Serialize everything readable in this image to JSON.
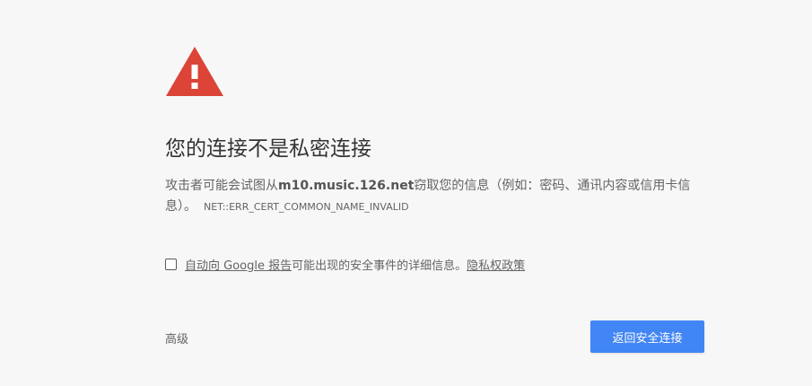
{
  "icon": {
    "name": "warning-icon",
    "color": "#db4437"
  },
  "title": "您的连接不是私密连接",
  "description": {
    "before_host": "攻击者可能会试图从",
    "host": "m10.music.126.net",
    "after_host": "窃取您的信息（例如：密码、通讯内容或信用卡信息）。",
    "error_code": "NET::ERR_CERT_COMMON_NAME_INVALID"
  },
  "report": {
    "link_label": "自动向 Google 报告",
    "middle_text": "可能出现的安全事件的详细信息。",
    "privacy_link": "隐私权政策"
  },
  "advanced_label": "高级",
  "back_button_label": "返回安全连接",
  "colors": {
    "accent": "#4285f4",
    "background": "#f7f7f7"
  }
}
